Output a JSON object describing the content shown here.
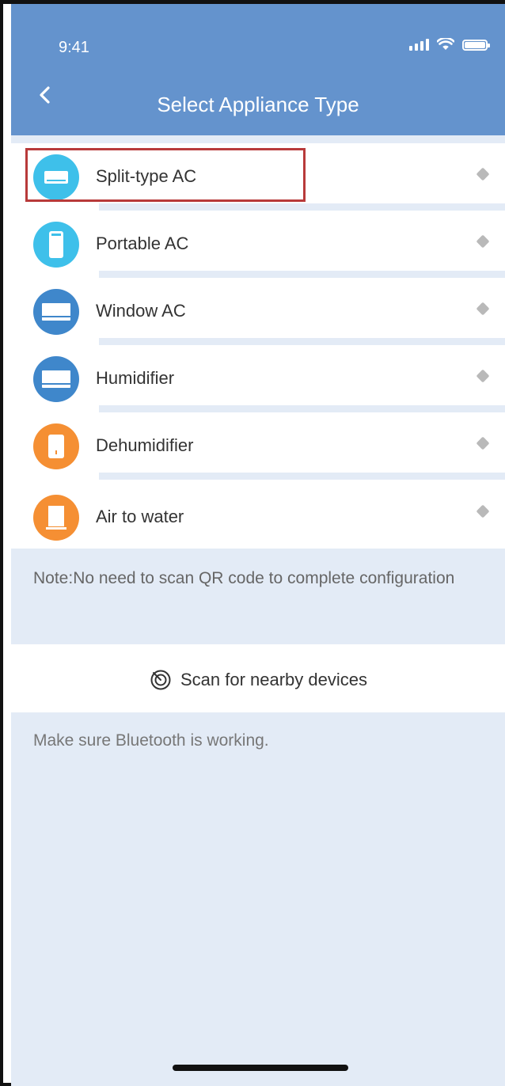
{
  "status_bar": {
    "time": "9:41"
  },
  "header": {
    "title": "Select Appliance Type"
  },
  "appliances": [
    {
      "label": "Split-type AC",
      "icon": "split-ac-icon",
      "color": "#3ec0ea"
    },
    {
      "label": "Portable AC",
      "icon": "portable-ac-icon",
      "color": "#3ec0ea"
    },
    {
      "label": "Window AC",
      "icon": "window-ac-icon",
      "color": "#3f87cb"
    },
    {
      "label": "Humidifier",
      "icon": "humidifier-icon",
      "color": "#3f87cb"
    },
    {
      "label": "Dehumidifier",
      "icon": "dehumidifier-icon",
      "color": "#f58f33"
    },
    {
      "label": "Air to water",
      "icon": "air-to-water-icon",
      "color": "#f58f33"
    }
  ],
  "note": "Note:No need to scan QR code to complete configuration",
  "scan": {
    "label": "Scan for nearby devices"
  },
  "bluetooth_hint": "Make sure Bluetooth is working.",
  "colors": {
    "header": "#6493cd",
    "background": "#e3ebf6",
    "highlight": "#b83a3a"
  }
}
